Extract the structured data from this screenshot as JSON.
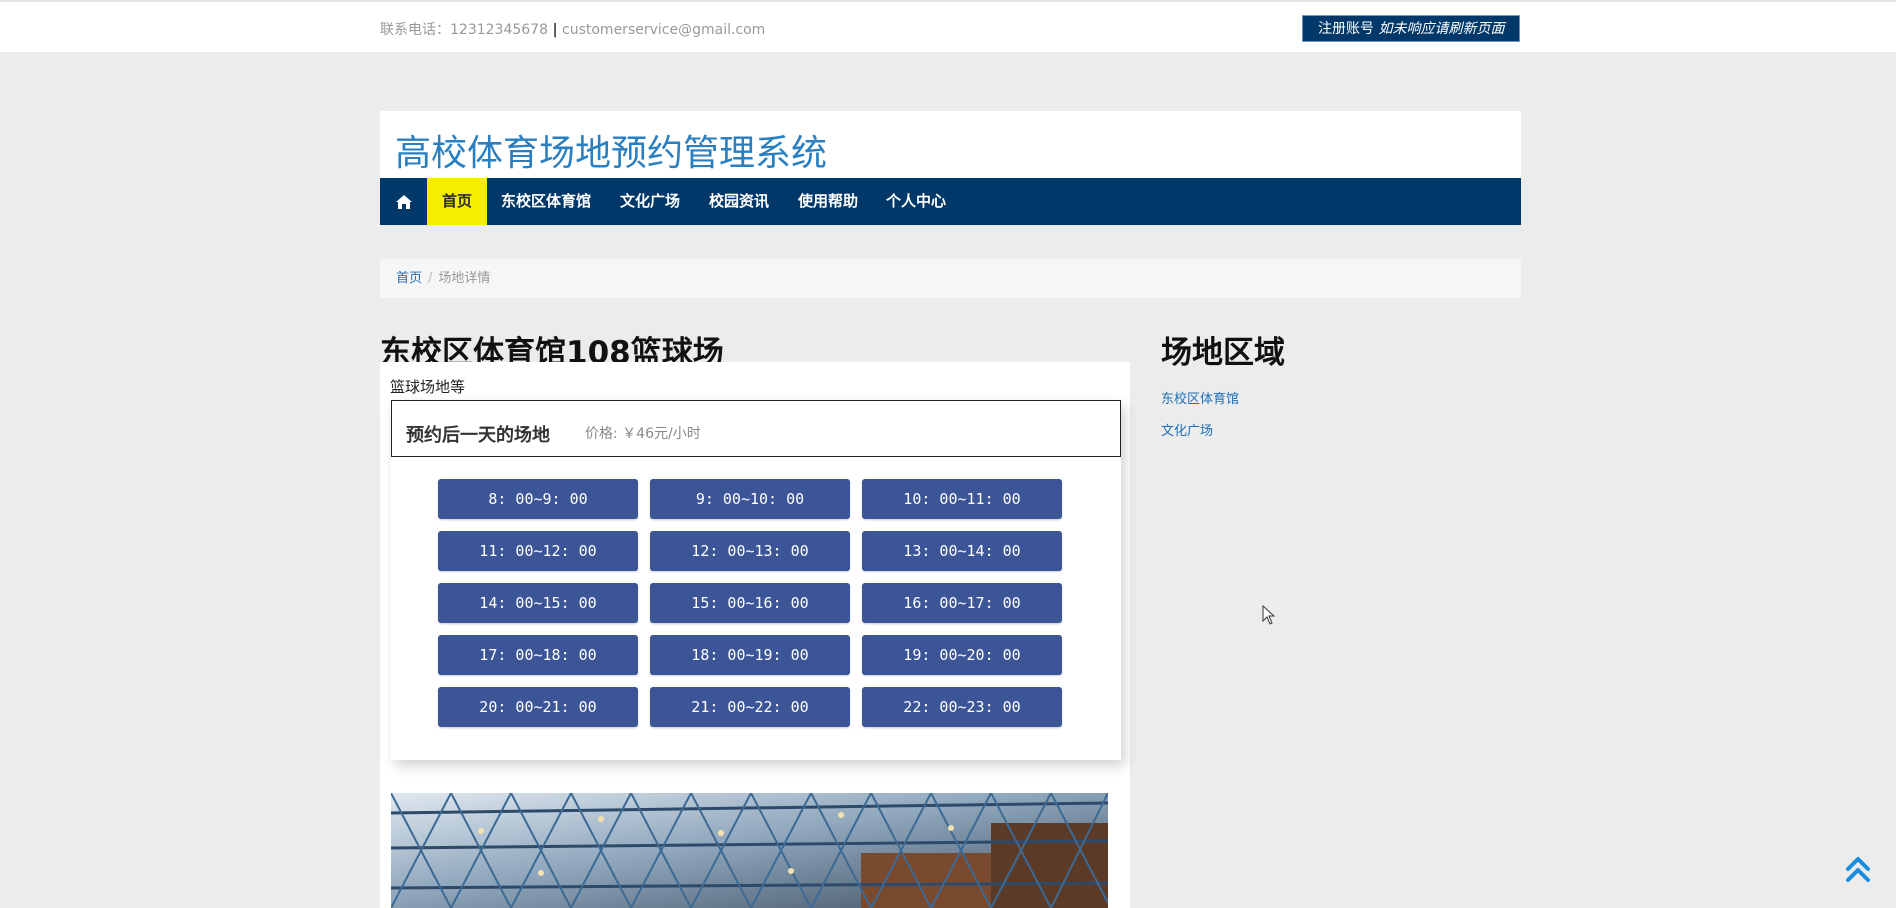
{
  "topbar": {
    "contact_label": "联系电话：",
    "phone": "12312345678",
    "separator": "|",
    "email": "customerservice@gmail.com",
    "register_label": "注册账号",
    "register_hint": "如未响应请刷新页面"
  },
  "header": {
    "title": "高校体育场地预约管理系统"
  },
  "nav": {
    "home_icon": "home-icon",
    "items": [
      "首页",
      "东校区体育馆",
      "文化广场",
      "校园资讯",
      "使用帮助",
      "个人中心"
    ]
  },
  "breadcrumb": {
    "home": "首页",
    "separator": "/",
    "current": "场地详情"
  },
  "venue": {
    "title": "东校区体育馆108篮球场",
    "description": "篮球场地等",
    "booking_label": "预约后一天的场地",
    "price_label": "价格:",
    "price_value": "￥46元/小时",
    "slots": [
      "8: 00~9: 00",
      "9: 00~10: 00",
      "10: 00~11: 00",
      "11: 00~12: 00",
      "12: 00~13: 00",
      "13: 00~14: 00",
      "14: 00~15: 00",
      "15: 00~16: 00",
      "16: 00~17: 00",
      "17: 00~18: 00",
      "18: 00~19: 00",
      "19: 00~20: 00",
      "20: 00~21: 00",
      "21: 00~22: 00",
      "22: 00~23: 00"
    ]
  },
  "sidebar": {
    "title": "场地区域",
    "links": [
      "东校区体育馆",
      "文化广场"
    ]
  },
  "colors": {
    "nav_bg": "#00386a",
    "nav_active": "#f5ee00",
    "slot_bg": "#3b5596",
    "title_blue": "#2a7fc0",
    "link_blue": "#1d6fb8"
  }
}
